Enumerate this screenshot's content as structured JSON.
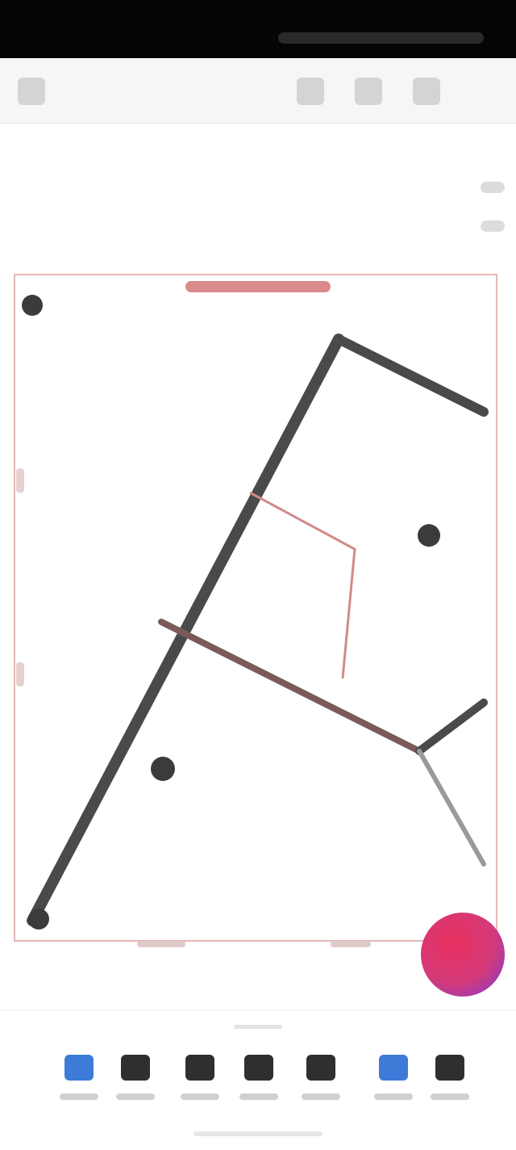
{
  "toolbar": {
    "icons": [
      "back-icon",
      "undo-icon",
      "redo-icon",
      "more-icon"
    ]
  },
  "plan": {
    "accent_color": "#c77a7a",
    "wall_color": "#3b3b3b"
  },
  "fab": {
    "icon": "add-icon",
    "colors": [
      "#e8305e",
      "#7a3bd6"
    ]
  },
  "bottom_tools": [
    {
      "icon": "wall-icon"
    },
    {
      "icon": "door-icon"
    },
    {
      "icon": "window-icon"
    },
    {
      "icon": "furniture-icon"
    },
    {
      "icon": "text-icon"
    },
    {
      "icon": "dimension-icon"
    },
    {
      "icon": "layers-icon"
    }
  ]
}
